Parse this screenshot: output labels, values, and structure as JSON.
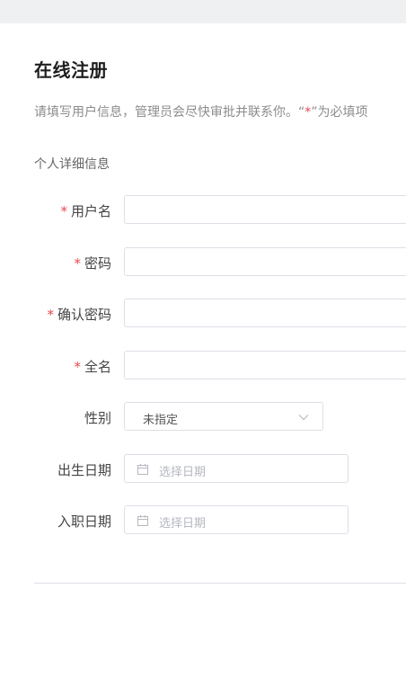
{
  "page": {
    "title": "在线注册",
    "description_prefix": "请填写用户信息，管理员会尽快审批并联系你。“",
    "description_star": "*",
    "description_suffix": "”为必填项"
  },
  "section": {
    "title": "个人详细信息"
  },
  "form": {
    "required_marker": "*",
    "username_label": "用户名",
    "password_label": "密码",
    "confirm_password_label": "确认密码",
    "fullname_label": "全名",
    "gender_label": "性别",
    "gender_value": "未指定",
    "birth_label": "出生日期",
    "birth_placeholder": "选择日期",
    "hire_label": "入职日期",
    "hire_placeholder": "选择日期"
  },
  "icons": {
    "calendar": "calendar-icon",
    "chevron": "chevron-down-icon"
  },
  "colors": {
    "required": "#e8484f",
    "border": "#dcdfe6",
    "placeholder": "#b5b8bf"
  }
}
